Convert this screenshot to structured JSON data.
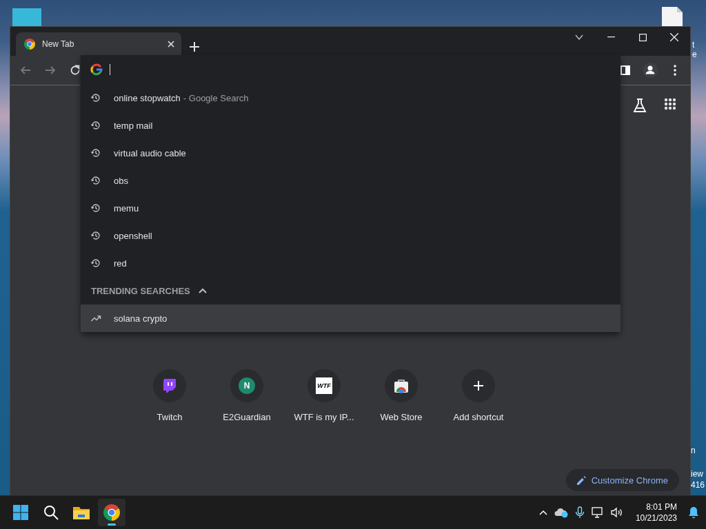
{
  "desktop": {
    "labels": [
      {
        "text": "t",
        "kind": "top"
      },
      {
        "text": "e",
        "kind": "top"
      },
      {
        "text": "n",
        "kind": "bottom"
      },
      {
        "text": "iew",
        "kind": "bottom"
      },
      {
        "text": "416",
        "kind": "bottom"
      }
    ]
  },
  "tabs": [
    {
      "title": "New Tab",
      "selected": true
    }
  ],
  "suggestions": [
    {
      "kind": "history",
      "text": "online stopwatch",
      "description": "- Google Search",
      "selected": false
    },
    {
      "kind": "history",
      "text": "temp mail",
      "selected": false
    },
    {
      "kind": "history",
      "text": "virtual audio cable",
      "selected": false
    },
    {
      "kind": "history",
      "text": "obs",
      "selected": false
    },
    {
      "kind": "history",
      "text": "memu",
      "selected": false
    },
    {
      "kind": "history",
      "text": "openshell",
      "selected": false
    },
    {
      "kind": "history",
      "text": "red",
      "selected": false
    }
  ],
  "trending": {
    "header": "TRENDING SEARCHES",
    "expanded": true,
    "items": [
      {
        "kind": "trend",
        "text": "solana crypto",
        "selected": true
      }
    ]
  },
  "shortcuts": [
    {
      "kind": "twitch",
      "label": "Twitch"
    },
    {
      "kind": "letter",
      "icon_text": "N",
      "label": "E2Guardian"
    },
    {
      "kind": "tile",
      "icon_text": "WTF",
      "label": "WTF is my IP..."
    },
    {
      "kind": "webstore",
      "label": "Web Store"
    },
    {
      "kind": "add",
      "label": "Add shortcut"
    }
  ],
  "customize_button": "Customize Chrome",
  "taskbar": {
    "apps": [
      {
        "kind": "start",
        "active": false
      },
      {
        "kind": "search",
        "active": false
      },
      {
        "kind": "folder",
        "active": false
      },
      {
        "kind": "chrome",
        "active": true
      }
    ],
    "time": "8:01 PM",
    "date": "10/21/2023"
  }
}
